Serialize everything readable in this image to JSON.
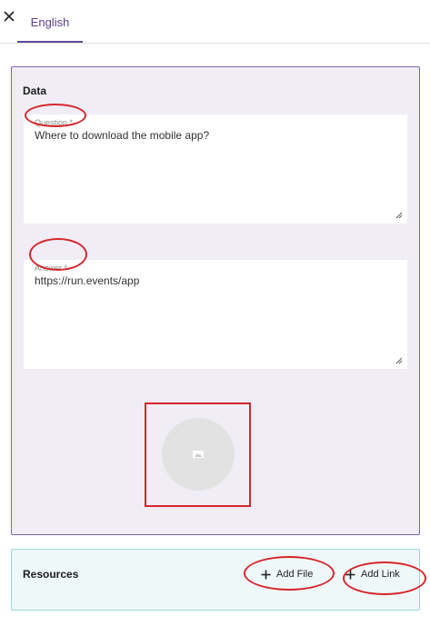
{
  "header": {
    "close_icon": "close-icon",
    "tab_label": "English"
  },
  "data_panel": {
    "title": "Data",
    "question": {
      "label": "Question *",
      "value": "Where to download the mobile app?"
    },
    "answer": {
      "label": "Answer *",
      "value": "https://run.events/app"
    },
    "image_icon": "image-placeholder-icon"
  },
  "resources_panel": {
    "title": "Resources",
    "add_file_label": "Add File",
    "add_link_label": "Add Link"
  },
  "colors": {
    "accent": "#5f4a99",
    "data_panel_bg": "#f0edf6",
    "data_panel_border": "#7a64b2",
    "resources_bg": "#eff8f9",
    "resources_border": "#9dd3dc",
    "annotation": "#d5262c"
  }
}
